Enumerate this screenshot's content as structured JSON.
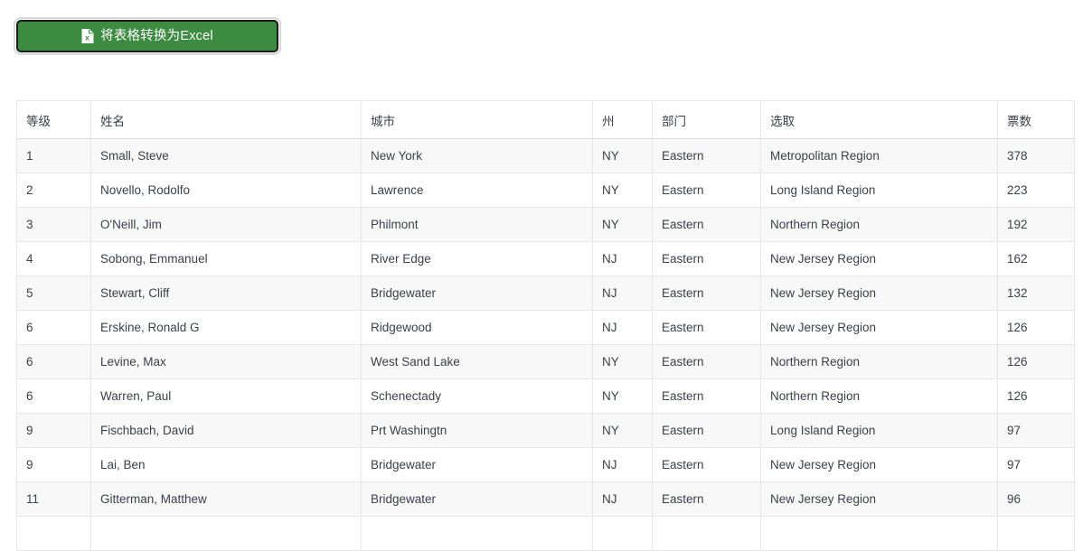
{
  "toolbar": {
    "export_button_label": "将表格转换为Excel",
    "export_icon": "excel-file-icon",
    "button_color": "#3c8b40",
    "button_text_color": "#ffffff",
    "button_border_color": "#1b1b1b"
  },
  "table": {
    "headers": [
      "等级",
      "姓名",
      "城市",
      "州",
      "部门",
      "选取",
      "票数"
    ],
    "rows": [
      [
        "1",
        "Small, Steve",
        "New York",
        "NY",
        "Eastern",
        "Metropolitan Region",
        "378"
      ],
      [
        "2",
        "Novello, Rodolfo",
        "Lawrence",
        "NY",
        "Eastern",
        "Long Island Region",
        "223"
      ],
      [
        "3",
        "O'Neill, Jim",
        "Philmont",
        "NY",
        "Eastern",
        "Northern Region",
        "192"
      ],
      [
        "4",
        "Sobong, Emmanuel",
        "River Edge",
        "NJ",
        "Eastern",
        "New Jersey Region",
        "162"
      ],
      [
        "5",
        "Stewart, Cliff",
        "Bridgewater",
        "NJ",
        "Eastern",
        "New Jersey Region",
        "132"
      ],
      [
        "6",
        "Erskine, Ronald G",
        "Ridgewood",
        "NJ",
        "Eastern",
        "New Jersey Region",
        "126"
      ],
      [
        "6",
        "Levine, Max",
        "West Sand Lake",
        "NY",
        "Eastern",
        "Northern Region",
        "126"
      ],
      [
        "6",
        "Warren, Paul",
        "Schenectady",
        "NY",
        "Eastern",
        "Northern Region",
        "126"
      ],
      [
        "9",
        "Fischbach, David",
        "Prt Washingtn",
        "NY",
        "Eastern",
        "Long Island Region",
        "97"
      ],
      [
        "9",
        "Lai, Ben",
        "Bridgewater",
        "NJ",
        "Eastern",
        "New Jersey Region",
        "97"
      ],
      [
        "11",
        "Gitterman, Matthew",
        "Bridgewater",
        "NJ",
        "Eastern",
        "New Jersey Region",
        "96"
      ],
      [
        "",
        "",
        "",
        "",
        "",
        "",
        ""
      ]
    ]
  }
}
